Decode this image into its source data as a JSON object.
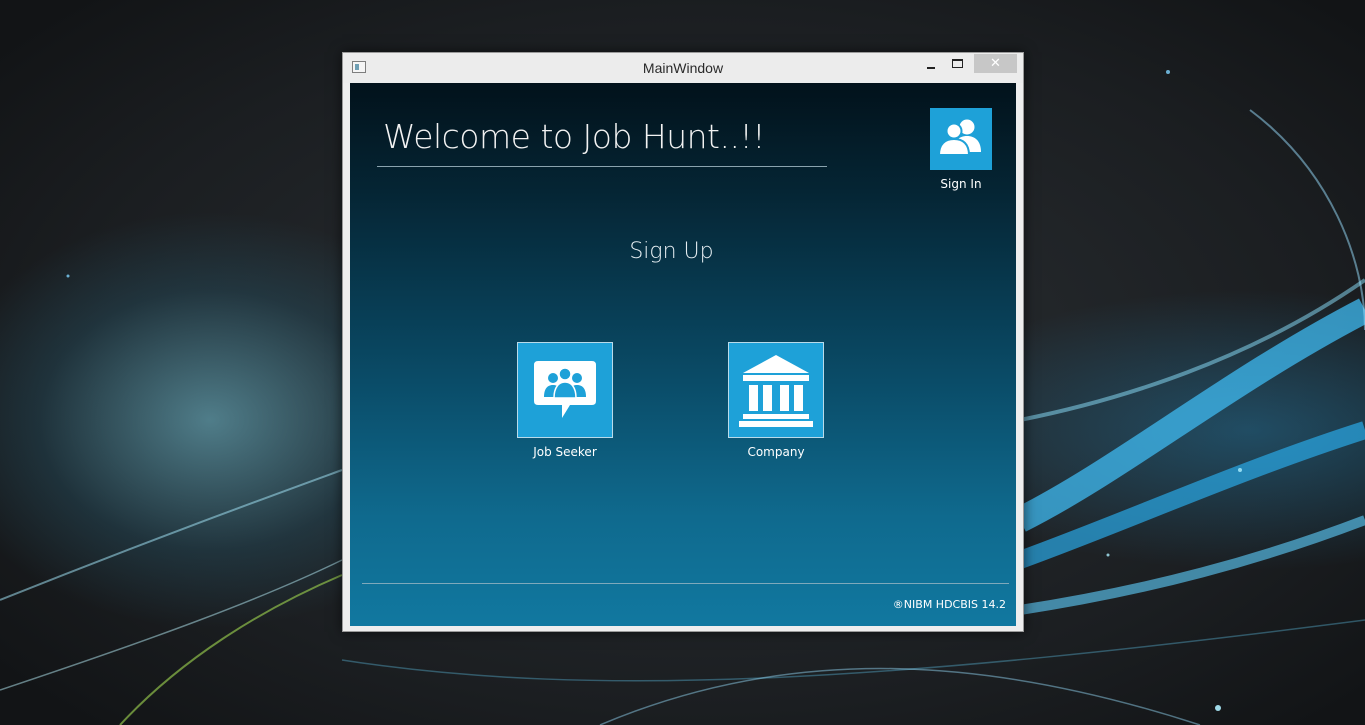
{
  "window": {
    "title": "MainWindow",
    "close_glyph": "✕",
    "controls": [
      "minimize-icon",
      "maximize-icon",
      "close-icon"
    ]
  },
  "main": {
    "welcome_title": "Welcome to Job Hunt..!!",
    "signin_label": "Sign In",
    "signin_icon": "users-icon",
    "signup_heading": "Sign Up",
    "tiles": [
      {
        "label": "Job Seeker",
        "icon": "chat-group-icon"
      },
      {
        "label": "Company",
        "icon": "building-icon"
      }
    ],
    "footer": "®NIBM HDCBIS 14.2"
  },
  "colors": {
    "tile_blue": "#1ea1d8",
    "background_top": "#02121b",
    "background_bottom": "#1178a0"
  }
}
